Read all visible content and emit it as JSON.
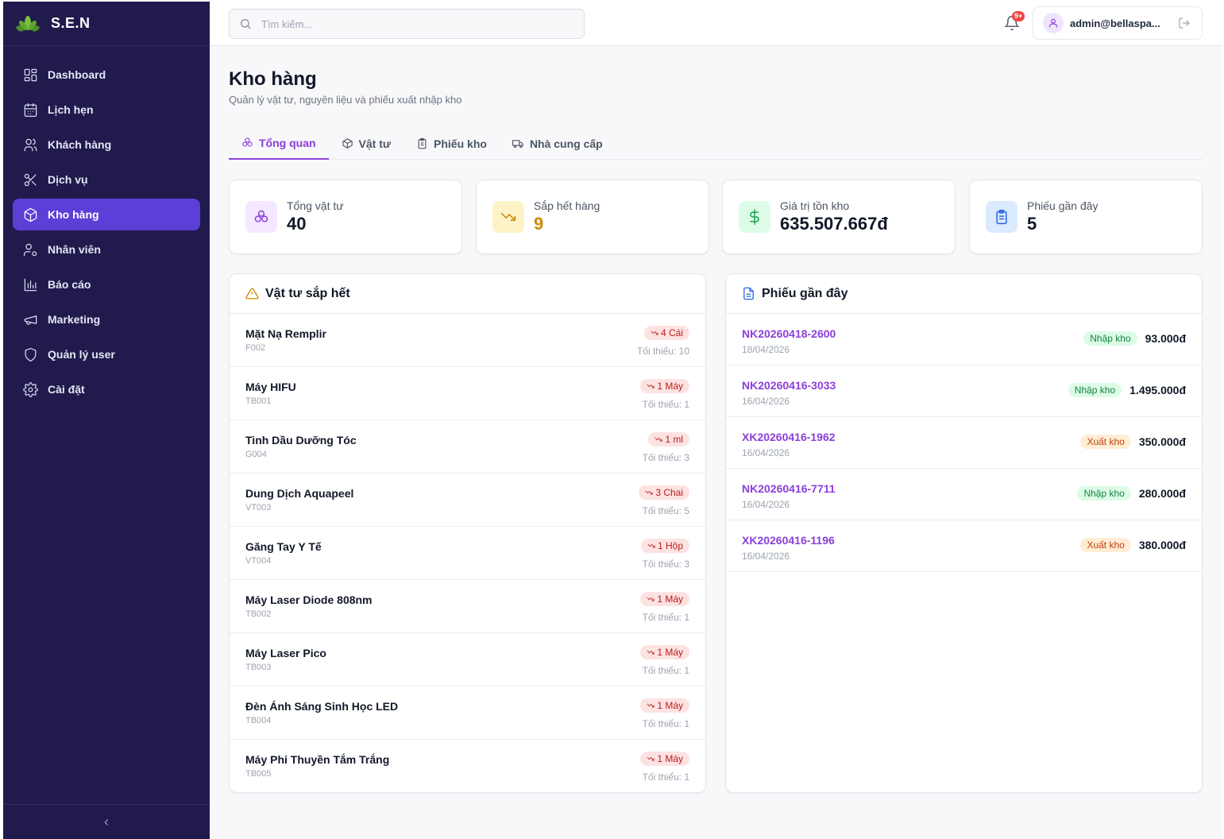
{
  "brand": {
    "name": "S.E.N"
  },
  "sidebar": {
    "items": [
      {
        "label": "Dashboard",
        "icon": "dashboard-icon"
      },
      {
        "label": "Lịch hẹn",
        "icon": "calendar-icon"
      },
      {
        "label": "Khách hàng",
        "icon": "users-icon"
      },
      {
        "label": "Dịch vụ",
        "icon": "scissors-icon"
      },
      {
        "label": "Kho hàng",
        "icon": "package-icon",
        "active": true
      },
      {
        "label": "Nhân viên",
        "icon": "user-cog-icon"
      },
      {
        "label": "Báo cáo",
        "icon": "bar-chart-icon"
      },
      {
        "label": "Marketing",
        "icon": "megaphone-icon"
      },
      {
        "label": "Quản lý user",
        "icon": "shield-icon"
      },
      {
        "label": "Cài đặt",
        "icon": "gear-icon"
      }
    ]
  },
  "header": {
    "search_placeholder": "Tìm kiếm...",
    "notification_count": "9+",
    "user_email": "admin@bellaspa..."
  },
  "page": {
    "title": "Kho hàng",
    "subtitle": "Quản lý vật tư, nguyên liệu và phiếu xuất nhập kho"
  },
  "tabs": [
    {
      "label": "Tổng quan",
      "icon": "cubes-icon"
    },
    {
      "label": "Vật tư",
      "icon": "box-icon"
    },
    {
      "label": "Phiếu kho",
      "icon": "clipboard-icon"
    },
    {
      "label": "Nhà cung cấp",
      "icon": "truck-icon"
    }
  ],
  "stats": [
    {
      "label": "Tổng vật tư",
      "value": "40",
      "icon": "cubes-icon",
      "color": "#8b3fd9"
    },
    {
      "label": "Sắp hết hàng",
      "value": "9",
      "icon": "trending-down-icon",
      "color": "#ca8a04"
    },
    {
      "label": "Giá trị tồn kho",
      "value": "635.507.667đ",
      "icon": "dollar-icon",
      "color": "#16a34a"
    },
    {
      "label": "Phiếu gần đây",
      "value": "5",
      "icon": "clipboard-icon",
      "color": "#2563eb"
    }
  ],
  "low_stock": {
    "title": "Vật tư sắp hết",
    "items": [
      {
        "name": "Mặt Nạ Remplir",
        "code": "F002",
        "stock": "4 Cái",
        "min": "Tối thiểu: 10"
      },
      {
        "name": "Máy HIFU",
        "code": "TB001",
        "stock": "1 Máy",
        "min": "Tối thiểu: 1"
      },
      {
        "name": "Tinh Dầu Dưỡng Tóc",
        "code": "G004",
        "stock": "1 ml",
        "min": "Tối thiểu: 3"
      },
      {
        "name": "Dung Dịch Aquapeel",
        "code": "VT003",
        "stock": "3 Chai",
        "min": "Tối thiểu: 5"
      },
      {
        "name": "Găng Tay Y Tế",
        "code": "VT004",
        "stock": "1 Hộp",
        "min": "Tối thiểu: 3"
      },
      {
        "name": "Máy Laser Diode 808nm",
        "code": "TB002",
        "stock": "1 Máy",
        "min": "Tối thiểu: 1"
      },
      {
        "name": "Máy Laser Pico",
        "code": "TB003",
        "stock": "1 Máy",
        "min": "Tối thiểu: 1"
      },
      {
        "name": "Đèn Ánh Sáng Sinh Học LED",
        "code": "TB004",
        "stock": "1 Máy",
        "min": "Tối thiểu: 1"
      },
      {
        "name": "Máy Phi Thuyền Tắm Trắng",
        "code": "TB005",
        "stock": "1 Máy",
        "min": "Tối thiểu: 1"
      }
    ]
  },
  "recent": {
    "title": "Phiếu gần đây",
    "items": [
      {
        "code": "NK20260418-2600",
        "date": "18/04/2026",
        "type": "Nhập kho",
        "kind": "in",
        "amount": "93.000đ"
      },
      {
        "code": "NK20260416-3033",
        "date": "16/04/2026",
        "type": "Nhập kho",
        "kind": "in",
        "amount": "1.495.000đ"
      },
      {
        "code": "XK20260416-1962",
        "date": "16/04/2026",
        "type": "Xuất kho",
        "kind": "out",
        "amount": "350.000đ"
      },
      {
        "code": "NK20260416-7711",
        "date": "16/04/2026",
        "type": "Nhập kho",
        "kind": "in",
        "amount": "280.000đ"
      },
      {
        "code": "XK20260416-1196",
        "date": "16/04/2026",
        "type": "Xuất kho",
        "kind": "out",
        "amount": "380.000đ"
      }
    ]
  }
}
